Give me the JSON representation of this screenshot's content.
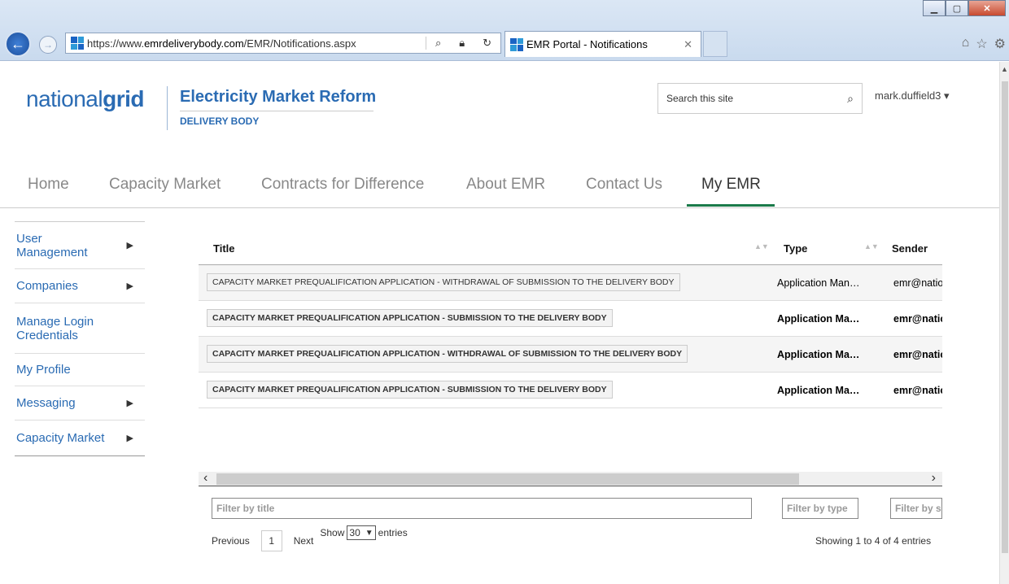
{
  "browser": {
    "url_prefix": "https://www.",
    "url_domain": "emrdeliverybody.com",
    "url_path": "/EMR/Notifications.aspx",
    "tab_title": "EMR Portal - Notifications"
  },
  "header": {
    "logo_light": "national",
    "logo_bold": "grid",
    "title": "Electricity Market Reform",
    "subtitle": "DELIVERY BODY",
    "search_placeholder": "Search this site",
    "user": "mark.duffield3 ▾"
  },
  "nav": {
    "items": [
      "Home",
      "Capacity Market",
      "Contracts for Difference",
      "About EMR",
      "Contact Us",
      "My EMR"
    ],
    "active": "My EMR"
  },
  "sidebar": {
    "items": [
      {
        "label": "User Management",
        "arrow": "▶"
      },
      {
        "label": "Companies",
        "arrow": "▶"
      },
      {
        "label": "Manage Login Credentials",
        "arrow": ""
      },
      {
        "label": "My Profile",
        "arrow": ""
      },
      {
        "label": "Messaging",
        "arrow": "▶"
      },
      {
        "label": "Capacity Market",
        "arrow": "▶"
      }
    ]
  },
  "table": {
    "headers": {
      "title": "Title",
      "type": "Type",
      "sender": "Sender"
    },
    "rows": [
      {
        "title": "CAPACITY MARKET PREQUALIFICATION APPLICATION - WITHDRAWAL OF SUBMISSION TO THE DELIVERY BODY",
        "type": "Application Man…",
        "sender": "emr@nation"
      },
      {
        "title": "CAPACITY MARKET PREQUALIFICATION APPLICATION - SUBMISSION TO THE DELIVERY BODY",
        "type": "Application Ma…",
        "sender": "emr@nation"
      },
      {
        "title": "CAPACITY MARKET PREQUALIFICATION APPLICATION - WITHDRAWAL OF SUBMISSION TO THE DELIVERY BODY",
        "type": "Application Ma…",
        "sender": "emr@nation"
      },
      {
        "title": "CAPACITY MARKET PREQUALIFICATION APPLICATION - SUBMISSION TO THE DELIVERY BODY",
        "type": "Application Ma…",
        "sender": "emr@nation"
      }
    ],
    "filters": {
      "title": "Filter by title",
      "type": "Filter by type",
      "sender": "Filter by s"
    }
  },
  "pager": {
    "previous": "Previous",
    "page": "1",
    "next": "Next",
    "show": "Show",
    "page_size": "30",
    "entries": "entries",
    "summary": "Showing 1 to 4 of 4 entries"
  },
  "colors": {
    "brand": "#2a6bb3",
    "active_nav_underline": "#1b7a4a"
  }
}
